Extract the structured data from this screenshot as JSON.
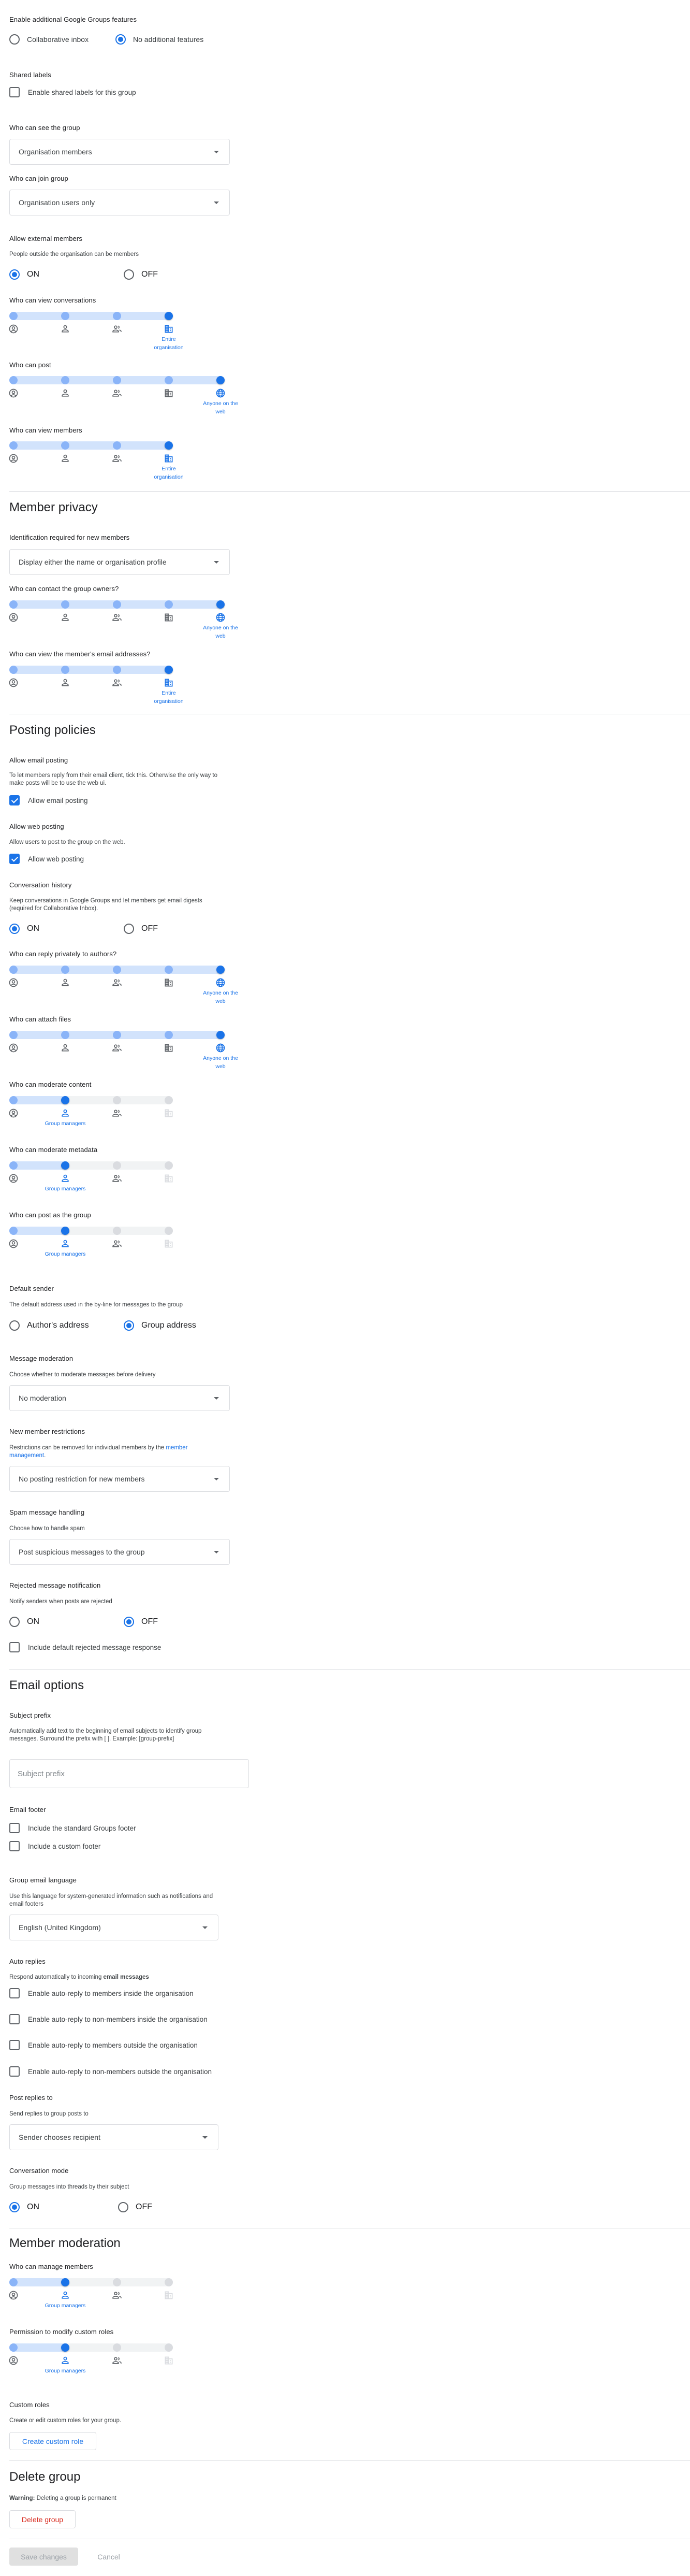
{
  "colors": {
    "accent": "#1a73e8",
    "danger": "#d93025",
    "track_active": "#d2e3fc",
    "dot_inrange": "#8ab4f8",
    "track_inactive": "#f1f3f4",
    "dot_inactive": "#dadce0"
  },
  "slider_levels": {
    "icons": [
      "account-circle-icon",
      "person-icon",
      "group-icon",
      "domain-icon",
      "globe-icon"
    ]
  },
  "features": {
    "label": "Enable additional Google Groups features",
    "options": [
      "Collaborative inbox",
      "No additional features"
    ],
    "selected": "No additional features"
  },
  "shared_labels": {
    "label": "Shared labels",
    "checkbox": "Enable shared labels for this group",
    "checked": false
  },
  "who_can_see": {
    "label": "Who can see the group",
    "value": "Organisation members"
  },
  "who_can_join": {
    "label": "Who can join group",
    "value": "Organisation users only"
  },
  "external_members": {
    "label": "Allow external members",
    "desc": "People outside the organisation can be members",
    "on_label": "ON",
    "off_label": "OFF",
    "value": "ON"
  },
  "sliders_access": [
    {
      "label": "Who can view conversations",
      "levels": 4,
      "selected_index": 3,
      "selected_caption": "Entire organisation"
    },
    {
      "label": "Who can post",
      "levels": 5,
      "selected_index": 4,
      "selected_caption": "Anyone on the web"
    },
    {
      "label": "Who can view members",
      "levels": 4,
      "selected_index": 3,
      "selected_caption": "Entire organisation"
    }
  ],
  "member_privacy": {
    "title": "Member privacy",
    "identification": {
      "label": "Identification required for new members",
      "value": "Display either the name or organisation profile"
    },
    "sliders": [
      {
        "label": "Who can contact the group owners?",
        "levels": 5,
        "selected_index": 4,
        "selected_caption": "Anyone on the web"
      },
      {
        "label": "Who can view the member's email addresses?",
        "levels": 4,
        "selected_index": 3,
        "selected_caption": "Entire organisation"
      }
    ]
  },
  "posting_policies": {
    "title": "Posting policies",
    "email_posting": {
      "label": "Allow email posting",
      "desc": "To let members reply from their email client, tick this. Otherwise the only way to make posts will be to use the web ui.",
      "checkbox": "Allow email posting",
      "checked": true
    },
    "web_posting": {
      "label": "Allow web posting",
      "desc": "Allow users to post to the group on the web.",
      "checkbox": "Allow web posting",
      "checked": true
    },
    "history": {
      "label": "Conversation history",
      "desc": "Keep conversations in Google Groups and let members get email digests (required for Collaborative Inbox).",
      "on_label": "ON",
      "off_label": "OFF",
      "value": "ON"
    },
    "sliders": [
      {
        "label": "Who can reply privately to authors?",
        "levels": 5,
        "selected_index": 4,
        "selected_caption": "Anyone on the web"
      },
      {
        "label": "Who can attach files",
        "levels": 5,
        "selected_index": 4,
        "selected_caption": "Anyone on the web"
      },
      {
        "label": "Who can moderate content",
        "levels": 4,
        "selected_index": 1,
        "selected_caption": "Group managers"
      },
      {
        "label": "Who can moderate metadata",
        "levels": 4,
        "selected_index": 1,
        "selected_caption": "Group managers"
      },
      {
        "label": "Who can post as the group",
        "levels": 4,
        "selected_index": 1,
        "selected_caption": "Group managers"
      }
    ],
    "default_sender": {
      "label": "Default sender",
      "desc": "The default address used in the by-line for messages to the group",
      "options": [
        "Author's address",
        "Group address"
      ],
      "selected": "Group address"
    },
    "message_moderation": {
      "label": "Message moderation",
      "desc": "Choose whether to moderate messages before delivery",
      "value": "No moderation"
    },
    "new_member_restrictions": {
      "label": "New member restrictions",
      "desc_prefix": "Restrictions can be removed for individual members by the ",
      "desc_link": "member management",
      "desc_suffix": ".",
      "value": "No posting restriction for new members"
    },
    "spam": {
      "label": "Spam message handling",
      "desc": "Choose how to handle spam",
      "value": "Post suspicious messages to the group"
    },
    "rejected": {
      "label": "Rejected message notification",
      "desc": "Notify senders when posts are rejected",
      "on_label": "ON",
      "off_label": "OFF",
      "value": "OFF",
      "checkbox": "Include default rejected message response",
      "checked": false
    }
  },
  "email_options": {
    "title": "Email options",
    "subject_prefix": {
      "label": "Subject prefix",
      "desc": "Automatically add text to the beginning of email subjects to identify group messages. Surround the prefix with [ ]. Example: [group-prefix]",
      "placeholder": "Subject prefix",
      "value": ""
    },
    "footer": {
      "label": "Email footer",
      "options": [
        {
          "label": "Include the standard Groups footer",
          "checked": false
        },
        {
          "label": "Include a custom footer",
          "checked": false
        }
      ]
    },
    "language": {
      "label": "Group email language",
      "desc": "Use this language for system-generated information such as notifications and email footers",
      "value": "English (United Kingdom)"
    },
    "auto_replies": {
      "label": "Auto replies",
      "desc_prefix": "Respond automatically to incoming ",
      "desc_bold": "email messages",
      "options": [
        {
          "label": "Enable auto-reply to members inside the organisation",
          "checked": false
        },
        {
          "label": "Enable auto-reply to non-members inside the organisation",
          "checked": false
        },
        {
          "label": "Enable auto-reply to members outside the organisation",
          "checked": false
        },
        {
          "label": "Enable auto-reply to non-members outside the organisation",
          "checked": false
        }
      ]
    },
    "post_replies": {
      "label": "Post replies to",
      "desc": "Send replies to group posts to",
      "value": "Sender chooses recipient"
    },
    "conversation_mode": {
      "label": "Conversation mode",
      "desc": "Group messages into threads by their subject",
      "on_label": "ON",
      "off_label": "OFF",
      "value": "ON"
    }
  },
  "member_moderation": {
    "title": "Member moderation",
    "sliders": [
      {
        "label": "Who can manage members",
        "levels": 4,
        "selected_index": 1,
        "selected_caption": "Group managers"
      },
      {
        "label": "Permission to modify custom roles",
        "levels": 4,
        "selected_index": 1,
        "selected_caption": "Group managers"
      }
    ],
    "custom_roles": {
      "label": "Custom roles",
      "desc": "Create or edit custom roles for your group.",
      "button": "Create custom role"
    }
  },
  "delete_group": {
    "title": "Delete group",
    "warning_bold": "Warning:",
    "warning_text": " Deleting a group is permanent",
    "button": "Delete group"
  },
  "footer": {
    "save": "Save changes",
    "cancel": "Cancel",
    "save_enabled": false
  }
}
